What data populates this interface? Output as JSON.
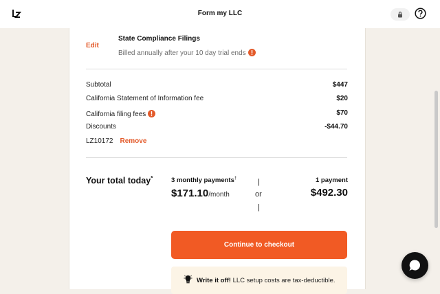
{
  "header": {
    "title": "Form my LLC",
    "logo_icon": "lz-logo-icon",
    "lock_icon": "lock-icon",
    "help_icon": "help-icon"
  },
  "filing": {
    "edit_label": "Edit",
    "title": "State Compliance Filings",
    "subtitle": "Billed annually after your 10 day trial ends"
  },
  "summary": {
    "rows": [
      {
        "label": "Subtotal",
        "value": "$447"
      },
      {
        "label": "California Statement of Information fee",
        "value": "$20"
      },
      {
        "label": "California filing fees",
        "value": "$70"
      },
      {
        "label": "Discounts",
        "value": "-$44.70"
      }
    ],
    "coupon_code": "LZ10172",
    "remove_label": "Remove"
  },
  "total": {
    "label": "Your total today",
    "marker": "*",
    "monthly_label": "3 monthly payments",
    "monthly_marker": "†",
    "monthly_amount": "$171.10",
    "monthly_unit": "/month",
    "separator_top": "|",
    "or_label": "or",
    "separator_bottom": "|",
    "single_label": "1 payment",
    "single_amount": "$492.30"
  },
  "checkout": {
    "label": "Continue to checkout"
  },
  "tip": {
    "bold": "Write it off!",
    "text": " LLC setup costs are tax-deductible."
  },
  "colors": {
    "accent": "#f15a24",
    "link": "#e35a2a",
    "background": "#f4f0ea",
    "tip_bg": "#fcf4e6"
  }
}
